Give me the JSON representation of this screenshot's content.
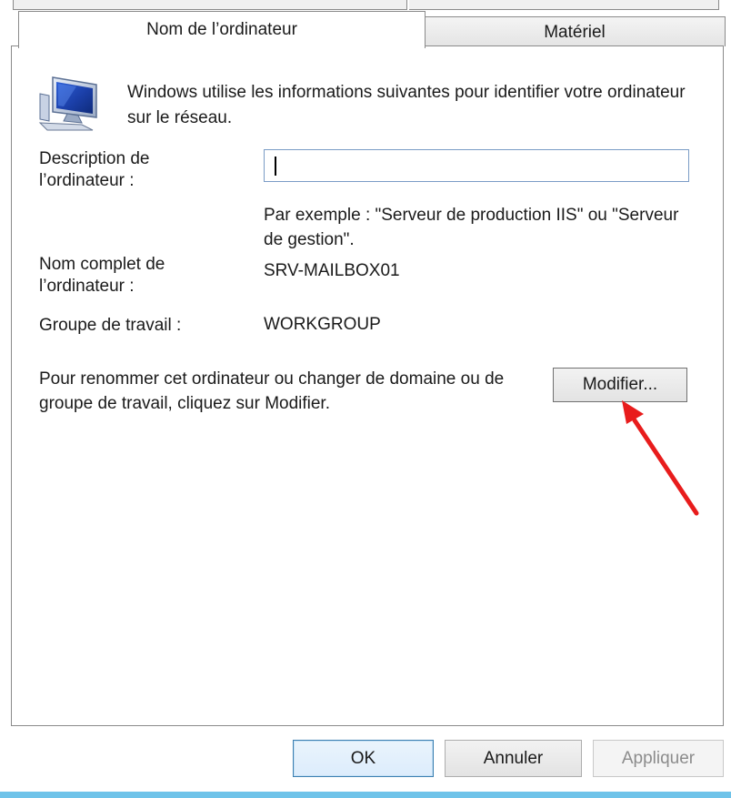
{
  "tabs": [
    {
      "label": "Nom de l’ordinateur",
      "active": true
    },
    {
      "label": "Matériel",
      "active": false
    }
  ],
  "intro_text": "Windows utilise les informations suivantes pour identifier votre ordinateur sur le réseau.",
  "description": {
    "label": "Description de l’ordinateur :",
    "value": "",
    "example": "Par exemple : \"Serveur de production IIS\" ou \"Serveur de gestion\"."
  },
  "full_name": {
    "label": "Nom complet de l’ordinateur :",
    "value": "SRV-MAILBOX01"
  },
  "workgroup": {
    "label": "Groupe de travail :",
    "value": "WORKGROUP"
  },
  "rename": {
    "text": "Pour renommer cet ordinateur ou changer de domaine ou de groupe de travail, cliquez sur Modifier.",
    "button": "Modifier..."
  },
  "footer": {
    "ok": "OK",
    "cancel": "Annuler",
    "apply": "Appliquer",
    "apply_enabled": false
  },
  "colors": {
    "arrow": "#e81c1c",
    "accent_bar": "#6fc3e9",
    "input_border": "#7a9cc6"
  },
  "icons": {
    "computer": "computer-monitor-icon",
    "annotation": "red-arrow-annotation"
  }
}
